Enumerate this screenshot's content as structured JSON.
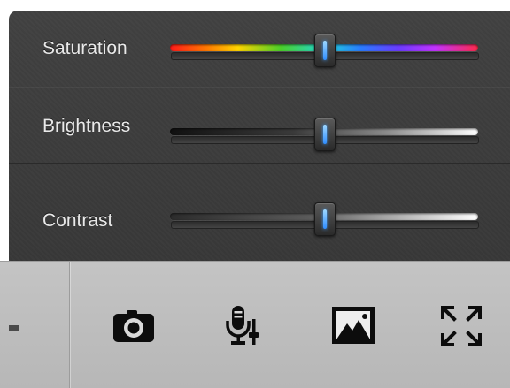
{
  "adjustments": {
    "items": [
      {
        "label": "Saturation",
        "value": 0.5
      },
      {
        "label": "Brightness",
        "value": 0.5
      },
      {
        "label": "Contrast",
        "value": 0.5
      }
    ]
  },
  "toolbar": {
    "icons": [
      "camera-icon",
      "microphone-settings-icon",
      "image-icon",
      "expand-icon"
    ]
  },
  "colors": {
    "panel": "#3b3b3b",
    "toolbar": "#bdbdbd",
    "thumb_accent": "#2f8dff"
  }
}
